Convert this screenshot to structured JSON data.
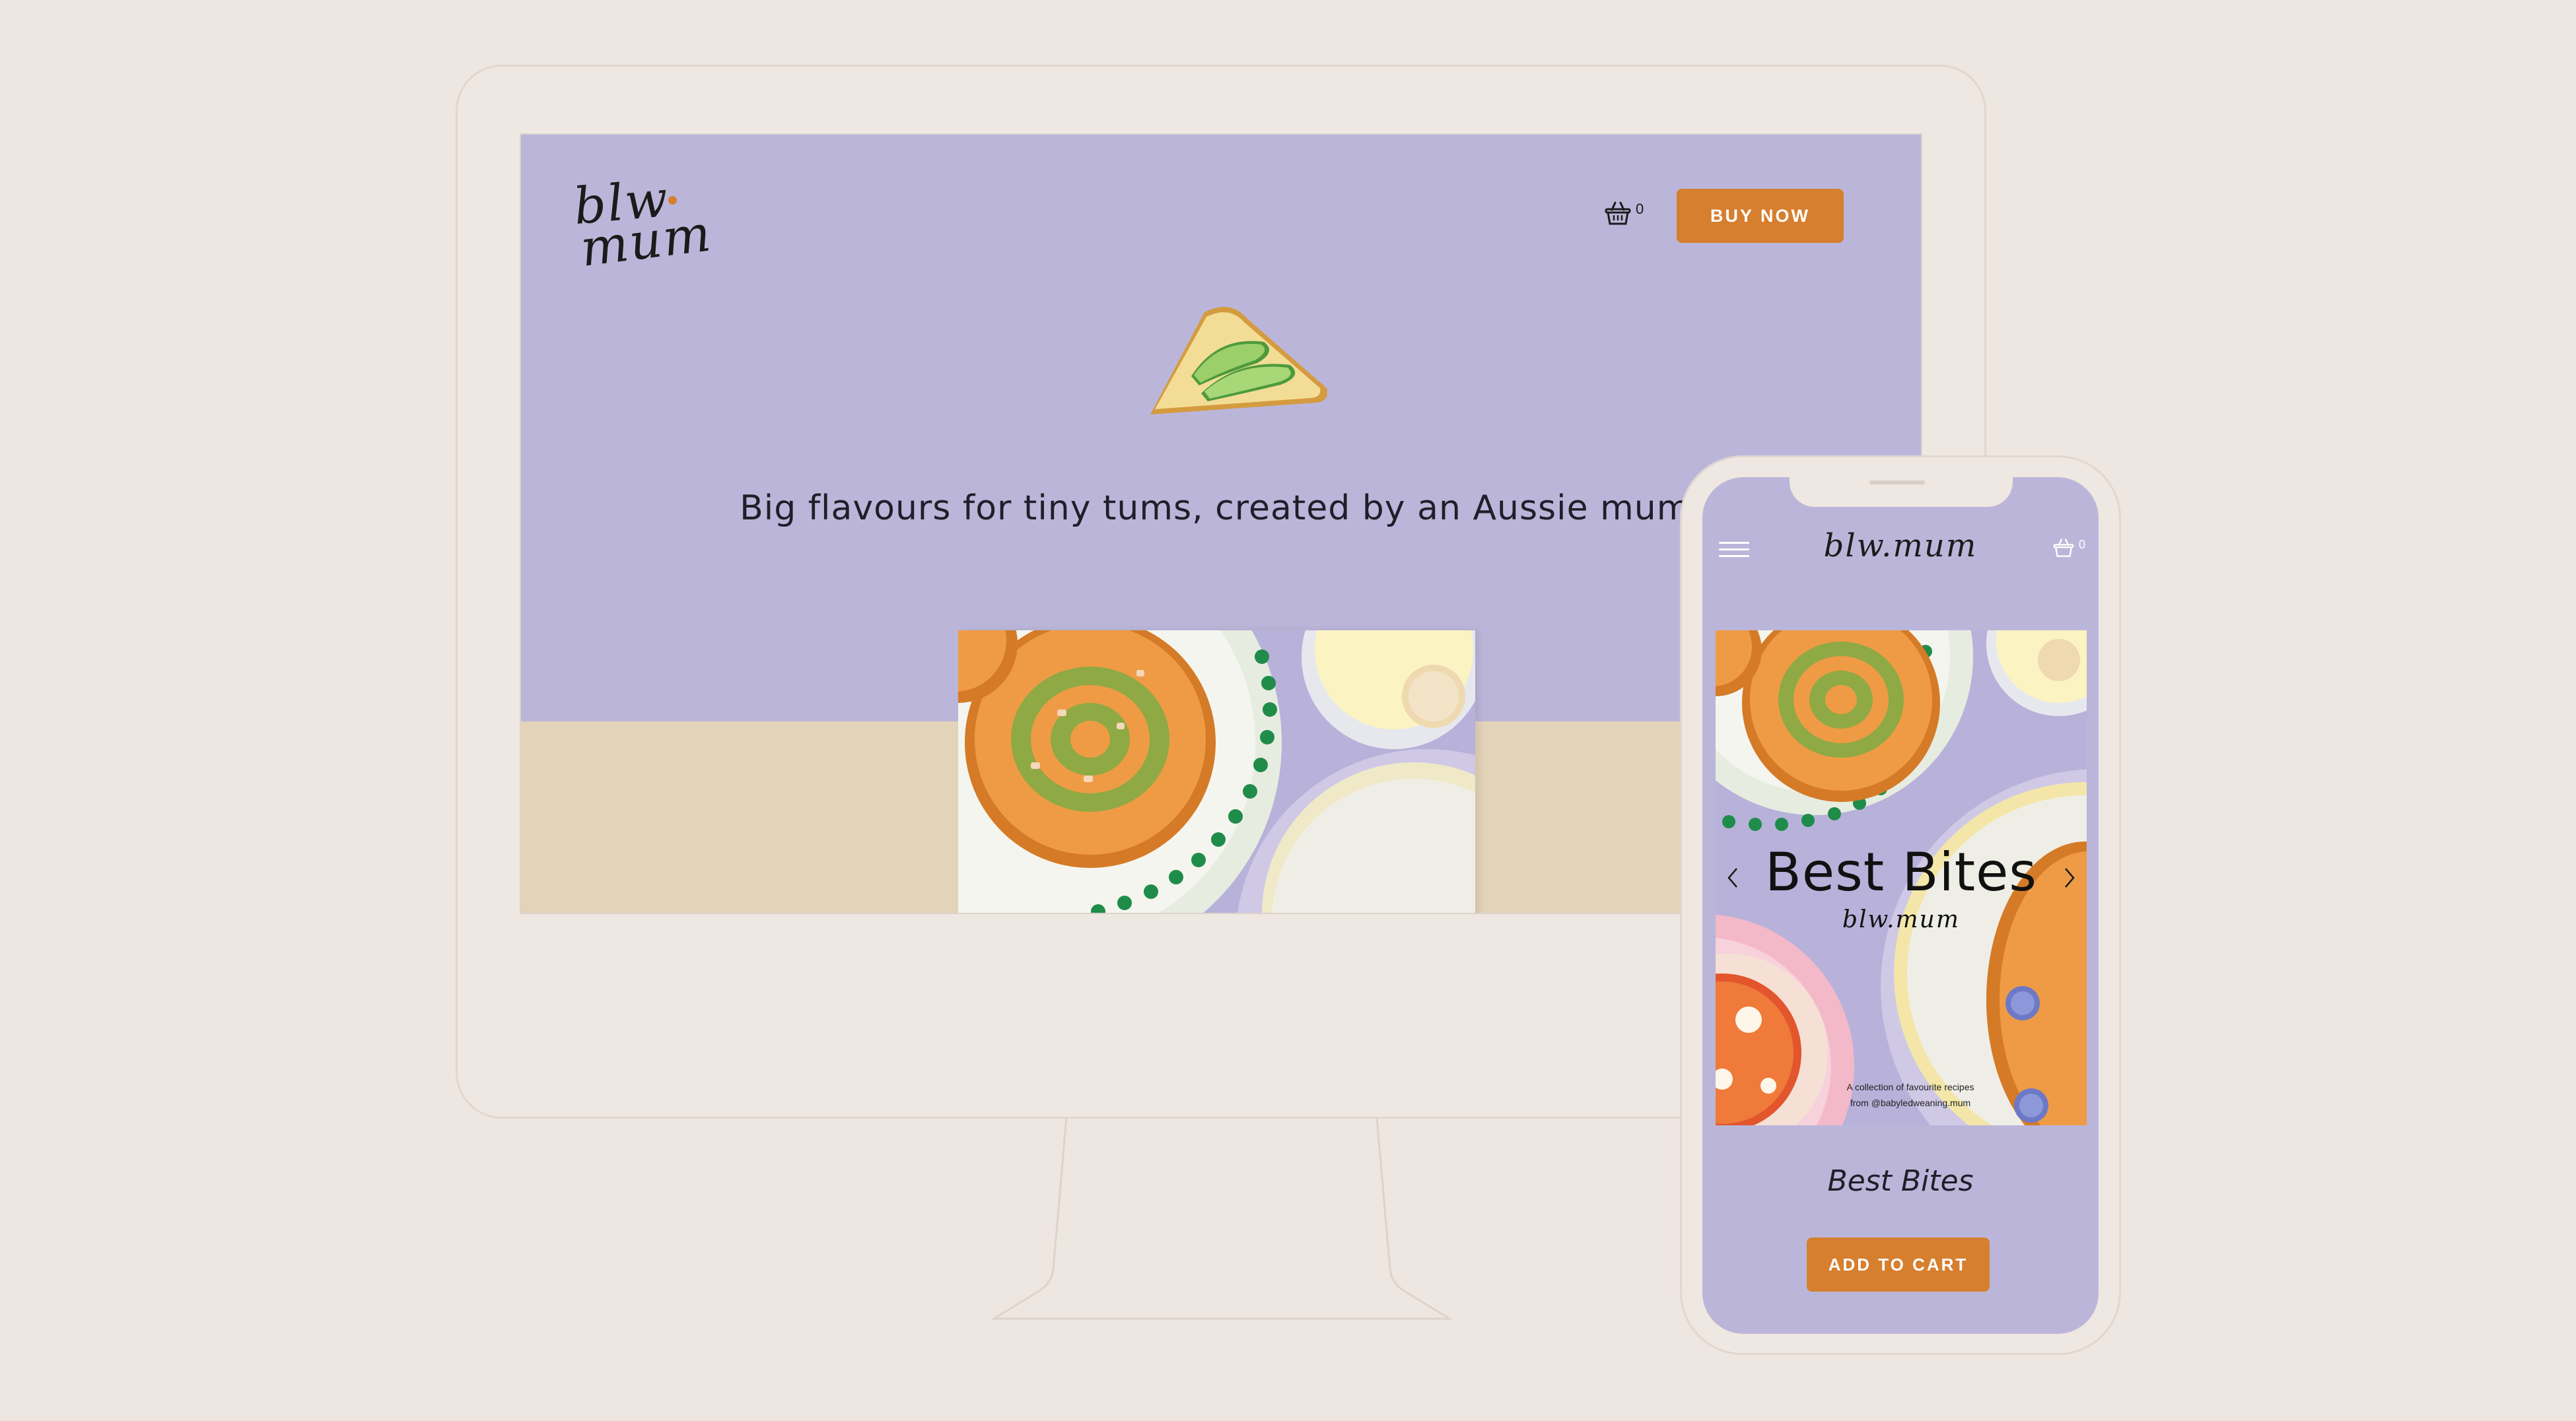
{
  "desktop": {
    "logo": {
      "line1": "blw",
      "line2": "mum"
    },
    "cart_count": "0",
    "buy_button": "BUY NOW",
    "tagline": "Big flavours for tiny tums, created by an Aussie mum."
  },
  "mobile": {
    "logo": "blw.mum",
    "cart_count": "0",
    "book": {
      "title": "Best Bites",
      "logo": "blw.mum",
      "note_line1": "A collection of favourite recipes",
      "note_line2": "from @babyledweaning.mum"
    },
    "product_name": "Best Bites",
    "add_to_cart_button": "ADD TO CART"
  },
  "colors": {
    "background": "#eee6e0",
    "lavender": "#bbb6d9",
    "accent_orange": "#d67f2f",
    "sand": "#e2d3b9"
  },
  "icons": [
    "basket-icon",
    "hamburger-menu-icon",
    "chevron-left-icon",
    "chevron-right-icon"
  ]
}
